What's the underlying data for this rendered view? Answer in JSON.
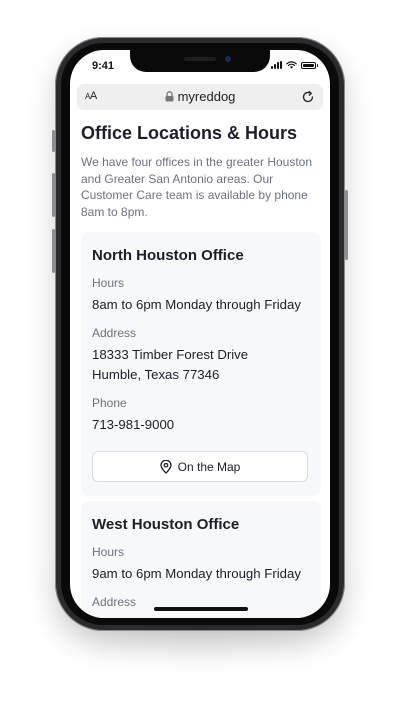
{
  "status_bar": {
    "time": "9:41"
  },
  "browser": {
    "text_size_label": "AA",
    "url": "myreddog"
  },
  "page": {
    "title": "Office Locations & Hours",
    "intro": "We have four offices in the greater Houston and Greater San Antonio areas. Our Customer Care team is available by phone 8am to 8pm."
  },
  "offices": [
    {
      "name": "North Houston Office",
      "hours_label": "Hours",
      "hours": "8am to 6pm Monday through Friday",
      "address_label": "Address",
      "address_line1": "18333 Timber Forest Drive",
      "address_line2": "Humble, Texas 77346",
      "phone_label": "Phone",
      "phone": "713-981-9000",
      "map_button": "On the Map"
    },
    {
      "name": "West Houston Office",
      "hours_label": "Hours",
      "hours": "9am to 6pm Monday through Friday",
      "address_label": "Address"
    }
  ],
  "colors": {
    "heading": "#1c1f2a",
    "muted": "#6b7280",
    "card_bg": "#f7f8fa"
  }
}
